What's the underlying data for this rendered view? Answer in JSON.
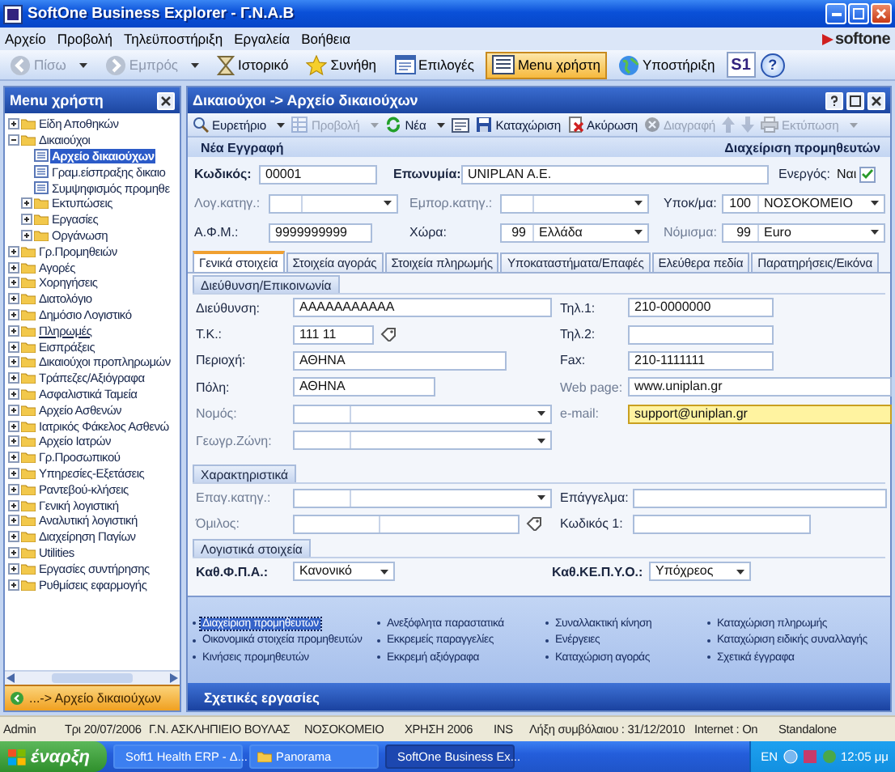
{
  "window": {
    "title": "SoftOne Business Explorer - Γ.Ν.Α.Β"
  },
  "menu": [
    "Αρχείο",
    "Προβολή",
    "Τηλεϋποστήριξη",
    "Εργαλεία",
    "Βοήθεια"
  ],
  "logo": "softone",
  "toolbar": [
    {
      "kind": "back",
      "label": "Πίσω",
      "disabled": true,
      "selected": false,
      "dropdown": true
    },
    {
      "kind": "forward",
      "label": "Εμπρός",
      "disabled": true,
      "selected": false,
      "dropdown": true
    },
    {
      "kind": "history",
      "label": "Ιστορικό",
      "disabled": false,
      "selected": false,
      "dropdown": false
    },
    {
      "kind": "favorites",
      "label": "Συνήθη",
      "disabled": false,
      "selected": false,
      "dropdown": false
    },
    {
      "kind": "options",
      "label": "Επιλογές",
      "disabled": false,
      "selected": false,
      "dropdown": false
    },
    {
      "kind": "menu",
      "label": "Menu χρήστη",
      "disabled": false,
      "selected": true,
      "dropdown": false
    },
    {
      "kind": "support",
      "label": "Υποστήριξη",
      "disabled": false,
      "selected": false,
      "dropdown": false
    },
    {
      "kind": "logo",
      "label": "S1",
      "disabled": false,
      "selected": false
    },
    {
      "kind": "help",
      "label": "?",
      "disabled": false,
      "selected": false
    }
  ],
  "sidebar": {
    "title": "Menu χρήστη",
    "footer": "...-> Αρχείο δικαιούχων",
    "items": [
      {
        "label": "Είδη Αποθηκών",
        "kind": "folder",
        "expanded": false,
        "selected": false,
        "hovered": false
      },
      {
        "label": "Δικαιούχοι",
        "kind": "folder",
        "expanded": true,
        "selected": false,
        "hovered": false,
        "children": [
          {
            "label": "Αρχείο δικαιούχων",
            "kind": "document",
            "selected": true,
            "hovered": false
          },
          {
            "label": "Γραμ.είσπραξης δικαιο",
            "kind": "document",
            "selected": false,
            "hovered": false
          },
          {
            "label": "Συμψηφισμός προμηθε",
            "kind": "document",
            "selected": false,
            "hovered": false
          },
          {
            "label": "Εκτυπώσεις",
            "kind": "folder",
            "expanded": false,
            "selected": false,
            "hovered": false
          },
          {
            "label": "Εργασίες",
            "kind": "folder",
            "expanded": false,
            "selected": false,
            "hovered": false
          },
          {
            "label": "Οργάνωση",
            "kind": "folder",
            "expanded": false,
            "selected": false,
            "hovered": false
          }
        ]
      },
      {
        "label": "Γρ.Προμηθειών",
        "kind": "folder",
        "expanded": false,
        "selected": false,
        "hovered": false
      },
      {
        "label": "Αγορές",
        "kind": "folder",
        "expanded": false,
        "selected": false,
        "hovered": false
      },
      {
        "label": "Χορηγήσεις",
        "kind": "folder",
        "expanded": false,
        "selected": false,
        "hovered": false
      },
      {
        "label": "Διατολόγιο",
        "kind": "folder",
        "expanded": false,
        "selected": false,
        "hovered": false
      },
      {
        "label": "Δημόσιο Λογιστικό",
        "kind": "folder",
        "expanded": false,
        "selected": false,
        "hovered": false
      },
      {
        "label": "Πληρωμές",
        "kind": "folder",
        "expanded": false,
        "selected": false,
        "hovered": true
      },
      {
        "label": "Εισπράξεις",
        "kind": "folder",
        "expanded": false,
        "selected": false,
        "hovered": false
      },
      {
        "label": "Δικαιούχοι προπληρωμών",
        "kind": "folder",
        "expanded": false,
        "selected": false,
        "hovered": false
      },
      {
        "label": "Τράπεζες/Αξιόγραφα",
        "kind": "folder",
        "expanded": false,
        "selected": false,
        "hovered": false
      },
      {
        "label": "Ασφαλιστικά Ταμεία",
        "kind": "folder",
        "expanded": false,
        "selected": false,
        "hovered": false
      },
      {
        "label": "Αρχείο Ασθενών",
        "kind": "folder",
        "expanded": false,
        "selected": false,
        "hovered": false
      },
      {
        "label": "Ιατρικός Φάκελος Ασθενώ",
        "kind": "folder",
        "expanded": false,
        "selected": false,
        "hovered": false
      },
      {
        "label": "Αρχείο Ιατρών",
        "kind": "folder",
        "expanded": false,
        "selected": false,
        "hovered": false
      },
      {
        "label": "Γρ.Προσωπικού",
        "kind": "folder",
        "expanded": false,
        "selected": false,
        "hovered": false
      },
      {
        "label": "Υπηρεσίες-Εξετάσεις",
        "kind": "folder",
        "expanded": false,
        "selected": false,
        "hovered": false
      },
      {
        "label": "Ραντεβού-κλήσεις",
        "kind": "folder",
        "expanded": false,
        "selected": false,
        "hovered": false
      },
      {
        "label": "Γενική λογιστική",
        "kind": "folder",
        "expanded": false,
        "selected": false,
        "hovered": false
      },
      {
        "label": "Αναλυτική λογιστική",
        "kind": "folder",
        "expanded": false,
        "selected": false,
        "hovered": false
      },
      {
        "label": "Διαχείρηση Παγίων",
        "kind": "folder",
        "expanded": false,
        "selected": false,
        "hovered": false
      },
      {
        "label": "Utilities",
        "kind": "folder",
        "expanded": false,
        "selected": false,
        "hovered": false
      },
      {
        "label": "Εργασίες συντήρησης",
        "kind": "folder",
        "expanded": false,
        "selected": false,
        "hovered": false
      },
      {
        "label": "Ρυθμίσεις εφαρμογής",
        "kind": "folder",
        "expanded": false,
        "selected": false,
        "hovered": false
      }
    ]
  },
  "panel": {
    "title": "Δικαιούχοι -> Αρχείο δικαιούχων",
    "toolbar": [
      {
        "kind": "index",
        "label": "Ευρετήριο",
        "disabled": false,
        "dropdown": true
      },
      {
        "kind": "view",
        "label": "Προβολή",
        "disabled": true,
        "dropdown": true
      },
      {
        "kind": "new",
        "label": "Νέα",
        "disabled": false,
        "dropdown": true
      },
      {
        "kind": "form",
        "disabled": false,
        "dropdown": false
      },
      {
        "kind": "save",
        "label": "Καταχώριση",
        "disabled": false,
        "dropdown": false
      },
      {
        "kind": "cancel",
        "label": "Ακύρωση",
        "disabled": false,
        "dropdown": false
      },
      {
        "kind": "delete",
        "label": "Διαγραφή",
        "disabled": true,
        "dropdown": false
      },
      {
        "kind": "prev",
        "disabled": true,
        "dropdown": false
      },
      {
        "kind": "next",
        "disabled": true,
        "dropdown": false
      },
      {
        "kind": "print",
        "label": "Εκτύπωση",
        "disabled": true,
        "dropdown": true
      }
    ],
    "record_state": "Νέα Εγγραφή",
    "context": "Διαχείριση προμηθευτών",
    "header_rows": [
      [
        {
          "kind": "text",
          "label": "Κωδικός:",
          "value": "00001",
          "required": true,
          "disabled": false,
          "focused": false
        },
        {
          "kind": "text",
          "label": "Επωνυμία:",
          "value": "UNIPLAN A.E.",
          "required": true,
          "disabled": false,
          "focused": false
        },
        {
          "kind": "check",
          "label": "Ενεργός:",
          "value": "Ναι",
          "checked": true,
          "required": false,
          "disabled": false
        }
      ],
      [
        {
          "kind": "combo",
          "label": "Λογ.κατηγ.:",
          "required": false,
          "disabled": true,
          "focused": false
        },
        {
          "kind": "combo",
          "label": "Εμπορ.κατηγ.:",
          "required": false,
          "disabled": true,
          "focused": false
        },
        {
          "kind": "combo",
          "label": "Υποκ/μα:",
          "code": "100",
          "value": "ΝΟΣΟΚΟΜΕΙΟ",
          "required": false,
          "disabled": false,
          "focused": false
        }
      ],
      [
        {
          "kind": "text",
          "label": "Α.Φ.Μ.:",
          "value": "9999999999",
          "required": false,
          "disabled": false,
          "focused": false
        },
        {
          "kind": "combo",
          "label": "Χώρα:",
          "code": "99",
          "value": "Ελλάδα",
          "required": false,
          "disabled": false,
          "focused": false
        },
        {
          "kind": "combo",
          "label": "Νόμισμα:",
          "code": "99",
          "value": "Euro",
          "required": false,
          "disabled": true,
          "focused": false
        }
      ]
    ],
    "tabs": [
      {
        "label": "Γενικά στοιχεία",
        "selected": true
      },
      {
        "label": "Στοιχεία αγοράς",
        "selected": false
      },
      {
        "label": "Στοιχεία πληρωμής",
        "selected": false
      },
      {
        "label": "Υποκαταστήματα/Επαφές",
        "selected": false
      },
      {
        "label": "Ελεύθερα πεδία",
        "selected": false
      },
      {
        "label": "Παρατηρήσεις/Εικόνα",
        "selected": false
      }
    ],
    "sections": [
      {
        "title": "Διεύθυνση/Επικοινωνία",
        "rows": [
          [
            {
              "kind": "text",
              "label": "Διεύθυνση:",
              "value": "AAAAAAAAAAA",
              "required": false,
              "disabled": false,
              "focused": false
            },
            {
              "kind": "text",
              "label": "Τηλ.1:",
              "value": "210-0000000",
              "required": false,
              "disabled": false,
              "focused": false
            }
          ],
          [
            {
              "kind": "lookup",
              "label": "Τ.Κ.:",
              "value": "111 11",
              "required": false,
              "disabled": false,
              "focused": false
            },
            {
              "kind": "text",
              "label": "Τηλ.2:",
              "required": false,
              "disabled": false,
              "focused": false
            }
          ],
          [
            {
              "kind": "text",
              "label": "Περιοχή:",
              "value": "ΑΘΗΝΑ",
              "required": false,
              "disabled": false,
              "focused": false
            },
            {
              "kind": "text",
              "label": "Fax:",
              "value": "210-1111111",
              "required": false,
              "disabled": false,
              "focused": false
            }
          ],
          [
            {
              "kind": "text",
              "label": "Πόλη:",
              "value": "ΑΘΗΝΑ",
              "required": false,
              "disabled": false,
              "focused": false
            },
            {
              "kind": "text",
              "label": "Web page:",
              "value": "www.uniplan.gr",
              "required": false,
              "disabled": true,
              "focused": false
            }
          ],
          [
            {
              "kind": "combo",
              "label": "Νομός:",
              "required": false,
              "disabled": true,
              "focused": false
            },
            {
              "kind": "text",
              "label": "e-mail:",
              "value": "support@uniplan.gr",
              "required": false,
              "disabled": true,
              "focused": true
            }
          ],
          [
            {
              "kind": "combo",
              "label": "Γεωγρ.Ζώνη:",
              "required": false,
              "disabled": true,
              "focused": false
            }
          ]
        ]
      },
      {
        "title": "Χαρακτηριστικά",
        "rows": [
          [
            {
              "kind": "combo",
              "label": "Επαγ.κατηγ.:",
              "required": false,
              "disabled": true,
              "focused": false
            },
            {
              "kind": "text",
              "label": "Επάγγελμα:",
              "required": false,
              "disabled": false,
              "focused": false
            }
          ],
          [
            {
              "kind": "group",
              "label": "Όμιλος:",
              "required": false,
              "disabled": true,
              "focused": false
            },
            {
              "kind": "text",
              "label": "Κωδικός 1:",
              "required": false,
              "disabled": false,
              "focused": false
            }
          ]
        ]
      },
      {
        "title": "Λογιστικά στοιχεία",
        "rows": [
          [
            {
              "kind": "select",
              "label": "Καθ.Φ.Π.Α.:",
              "value": "Κανονικό",
              "required": true,
              "disabled": false,
              "focused": false
            },
            {
              "kind": "select",
              "label": "Καθ.ΚΕ.Π.Υ.Ο.:",
              "value": "Υπόχρεος",
              "required": true,
              "disabled": false,
              "focused": false
            }
          ]
        ]
      }
    ],
    "links": [
      [
        {
          "label": "Διαχείριση προμηθευτών",
          "selected": true
        },
        {
          "label": "Οικονομικά στοιχεία προμηθευτών",
          "selected": false
        },
        {
          "label": "Κινήσεις προμηθευτών",
          "selected": false
        }
      ],
      [
        {
          "label": "Ανεξόφλητα παραστατικά",
          "selected": false
        },
        {
          "label": "Εκκρεμείς παραγγελίες",
          "selected": false
        },
        {
          "label": "Εκκρεμή αξιόγραφα",
          "selected": false
        }
      ],
      [
        {
          "label": "Συναλλακτική κίνηση",
          "selected": false
        },
        {
          "label": "Ενέργειες",
          "selected": false
        },
        {
          "label": "Καταχώριση αγοράς",
          "selected": false
        }
      ],
      [
        {
          "label": "Καταχώριση πληρωμής",
          "selected": false
        },
        {
          "label": "Καταχώριση ειδικής συναλλαγής",
          "selected": false
        },
        {
          "label": "Σχετικά έγγραφα",
          "selected": false
        }
      ]
    ],
    "links_title": "Σχετικές εργασίες"
  },
  "status_bar": [
    "Admin",
    "Τρι 20/07/2006",
    "Γ.Ν. ΑΣΚΛΗΠΙΕΙΟ ΒΟΥΛΑΣ",
    "ΝΟΣΟΚΟΜΕΙΟ",
    "ΧΡΗΣΗ 2006",
    "INS",
    "Λήξη συμβόλαιου : 31/12/2010",
    "Internet : On",
    "Standalone"
  ],
  "taskbar": {
    "start": "έναρξη",
    "tasks": [
      {
        "label": "Soft1 Health ERP - Δ...",
        "kind": "app",
        "selected": false
      },
      {
        "label": "Panorama",
        "kind": "folder",
        "selected": false
      },
      {
        "label": "SoftOne Business Ex...",
        "kind": "app",
        "selected": true
      }
    ],
    "language": "EN",
    "clock": "12:05 μμ"
  }
}
